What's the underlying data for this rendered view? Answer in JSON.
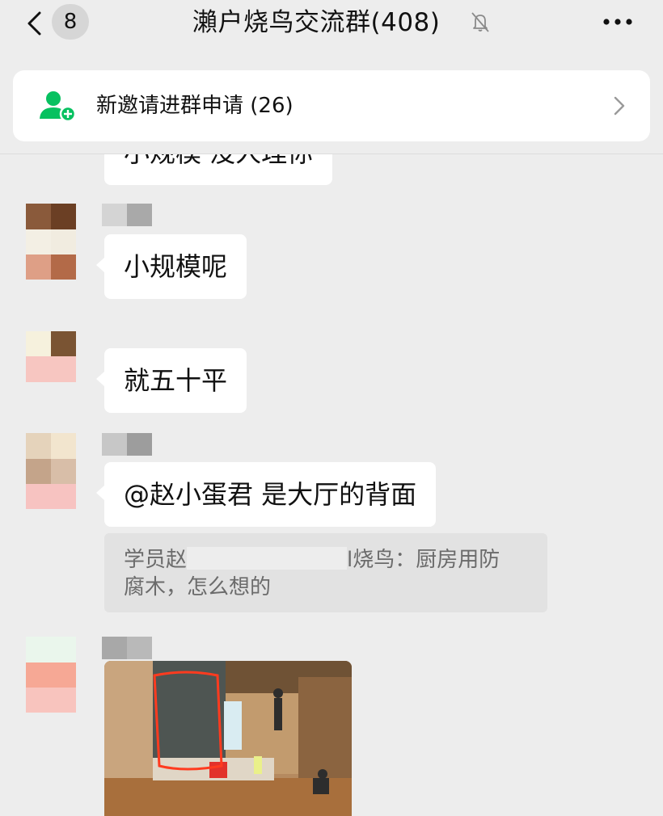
{
  "nav": {
    "unread_count": "8",
    "title": "瀨户烧鸟交流群(408)",
    "back_icon": "chevron-left-icon",
    "mute_icon": "bell-muted-icon",
    "more_icon": "more-icon"
  },
  "notice": {
    "text": "新邀请进群申请 (26)",
    "icon": "add-member-icon",
    "arrow_icon": "chevron-right-icon"
  },
  "messages": [
    {
      "type": "text",
      "text": "小规模 没人理你"
    },
    {
      "type": "text",
      "text": "小规模呢"
    },
    {
      "type": "text",
      "text": "就五十平"
    },
    {
      "type": "text",
      "text": "@赵小蛋君 是大厅的背面",
      "quote": {
        "prefix": "学员赵",
        "suffix": "l烧鸟：厨房用防",
        "line2": "腐木，怎么想的"
      }
    },
    {
      "type": "image",
      "description": "kitchen-photo"
    }
  ],
  "colors": {
    "background": "#ededed",
    "bubble": "#ffffff",
    "wechat_green": "#07c160",
    "highlight_red": "#ff3b1f"
  }
}
